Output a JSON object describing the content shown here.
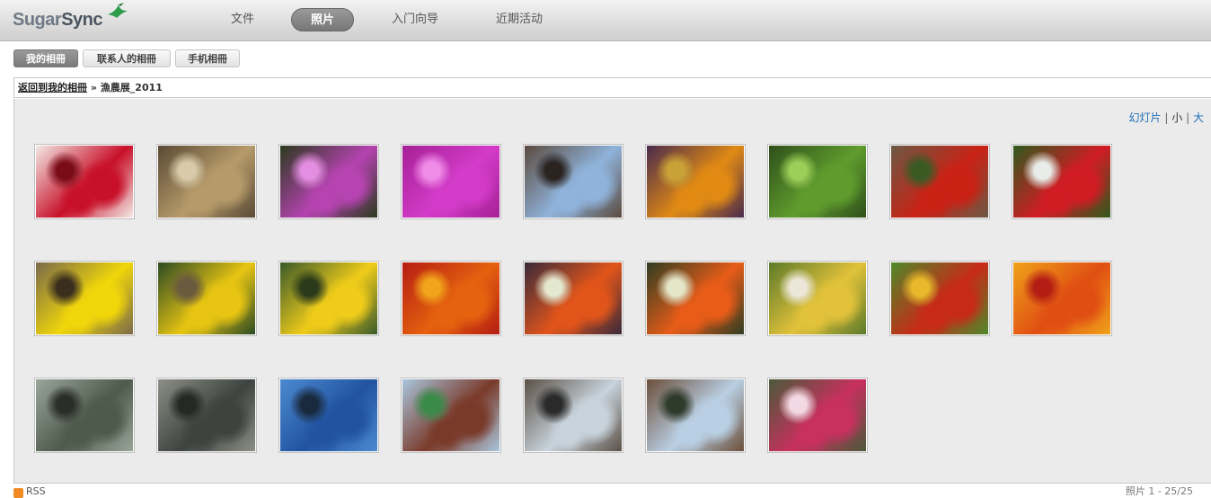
{
  "app": {
    "logo_text_a": "Sugar",
    "logo_text_b": "Sync",
    "logo_name": "sugarsync-logo"
  },
  "nav": {
    "items": [
      {
        "label": "文件",
        "active": false
      },
      {
        "label": "照片",
        "active": true
      },
      {
        "label": "入门向导",
        "active": false
      },
      {
        "label": "近期活动",
        "active": false
      }
    ]
  },
  "subtabs": [
    {
      "label": "我的相冊",
      "active": true
    },
    {
      "label": "联系人的相冊",
      "active": false
    },
    {
      "label": "手机相冊",
      "active": false
    }
  ],
  "breadcrumb": {
    "back_link": "返回到我的相冊",
    "separator": "»",
    "current": "漁農展_2011"
  },
  "view_options": {
    "slideshow": "幻灯片",
    "sep1": "|",
    "small": "小",
    "sep2": "|",
    "large": "大",
    "current": "small"
  },
  "footer": {
    "rss_label": "RSS",
    "right_text": "照片 1 - 25/25"
  },
  "photos": [
    {
      "subject": "red apples",
      "colors": [
        "#c8102a",
        "#f3e9e4",
        "#7a0c18"
      ]
    },
    {
      "subject": "market produce",
      "colors": [
        "#b69a6a",
        "#5a4a35",
        "#d9cba9"
      ]
    },
    {
      "subject": "pink orchids",
      "colors": [
        "#b543b0",
        "#2b3a1e",
        "#e38ee0"
      ]
    },
    {
      "subject": "magenta orchids",
      "colors": [
        "#d33bc8",
        "#a52196",
        "#f08ce8"
      ]
    },
    {
      "subject": "market street",
      "colors": [
        "#8fb3db",
        "#5b4a3e",
        "#2a2320"
      ]
    },
    {
      "subject": "squash and eggplant",
      "colors": [
        "#e08a14",
        "#4a2a4d",
        "#c9a237"
      ]
    },
    {
      "subject": "green tomatoes",
      "colors": [
        "#5f9c2d",
        "#2f4f1b",
        "#9ccf59"
      ]
    },
    {
      "subject": "red peppers",
      "colors": [
        "#c92215",
        "#6b5a45",
        "#3a5a24"
      ]
    },
    {
      "subject": "strawberries",
      "colors": [
        "#d11c24",
        "#2f5a1e",
        "#e9ece8"
      ]
    },
    {
      "subject": "yellow peppers",
      "colors": [
        "#f0d60a",
        "#7a6a4a",
        "#3a2e1e"
      ]
    },
    {
      "subject": "squash flower",
      "colors": [
        "#e8c512",
        "#2c4a24",
        "#6a5a3e"
      ]
    },
    {
      "subject": "squash flower",
      "colors": [
        "#f0cc1a",
        "#3a5a2a",
        "#2a3a1a"
      ]
    },
    {
      "subject": "orange peppers",
      "colors": [
        "#e5620f",
        "#b51d12",
        "#f2a51b"
      ]
    },
    {
      "subject": "mixed peppers",
      "colors": [
        "#e2551a",
        "#3a2a3a",
        "#e4e8cf"
      ]
    },
    {
      "subject": "mixed peppers",
      "colors": [
        "#e85c18",
        "#2f3d22",
        "#e3e6c8"
      ]
    },
    {
      "subject": "cauliflower and bananas",
      "colors": [
        "#e2c23a",
        "#5c7a2a",
        "#ece7d8"
      ]
    },
    {
      "subject": "tomatoes and cucumbers",
      "colors": [
        "#c72a18",
        "#4e8a2a",
        "#e9b92b"
      ]
    },
    {
      "subject": "chili peppers",
      "colors": [
        "#e04e12",
        "#f0a21a",
        "#b31d14"
      ]
    },
    {
      "subject": "fish tank",
      "colors": [
        "#4e5a4c",
        "#9aa59a",
        "#2a2e28"
      ]
    },
    {
      "subject": "fish tank",
      "colors": [
        "#3e4340",
        "#8c8f86",
        "#262826"
      ]
    },
    {
      "subject": "grouper in tank",
      "colors": [
        "#2153a1",
        "#4c8ad0",
        "#1a2a3e"
      ]
    },
    {
      "subject": "hanging fish",
      "colors": [
        "#7a3a2a",
        "#a9c6de",
        "#3a8a4a"
      ]
    },
    {
      "subject": "market building",
      "colors": [
        "#c8d3dc",
        "#5a5046",
        "#2a2a2a"
      ]
    },
    {
      "subject": "market building",
      "colors": [
        "#b9cfe3",
        "#6b4e3a",
        "#2e3a2a"
      ]
    },
    {
      "subject": "pink flowers",
      "colors": [
        "#c8305e",
        "#4a5a3a",
        "#f3d9e3"
      ]
    }
  ]
}
